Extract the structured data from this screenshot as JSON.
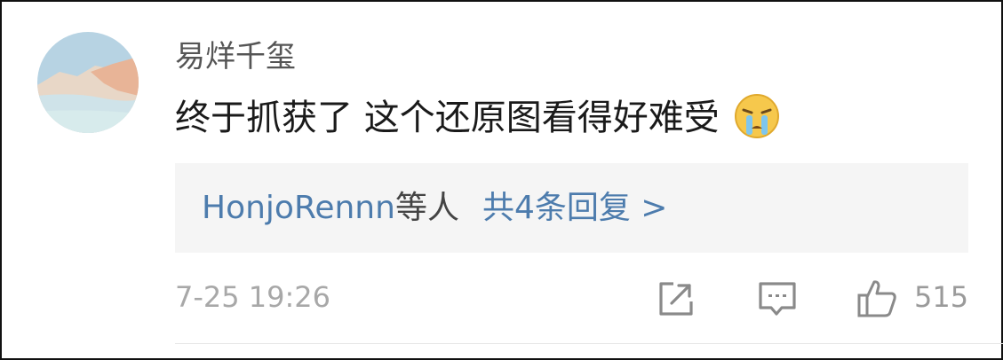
{
  "comment": {
    "username": "易烊千玺",
    "text": "终于抓获了 这个还原图看得好难受",
    "emoji": "crying-face-icon",
    "time": "7-25 19:26",
    "likes": "515"
  },
  "replies": {
    "user": "HonjoRennn",
    "suffix": "等人",
    "count_label": "共4条回复 >"
  },
  "icons": [
    "share-icon",
    "comment-icon",
    "like-icon"
  ],
  "colors": {
    "link": "#4d7cad",
    "reply_bg": "#f5f5f5",
    "meta": "#a8a8a8"
  }
}
